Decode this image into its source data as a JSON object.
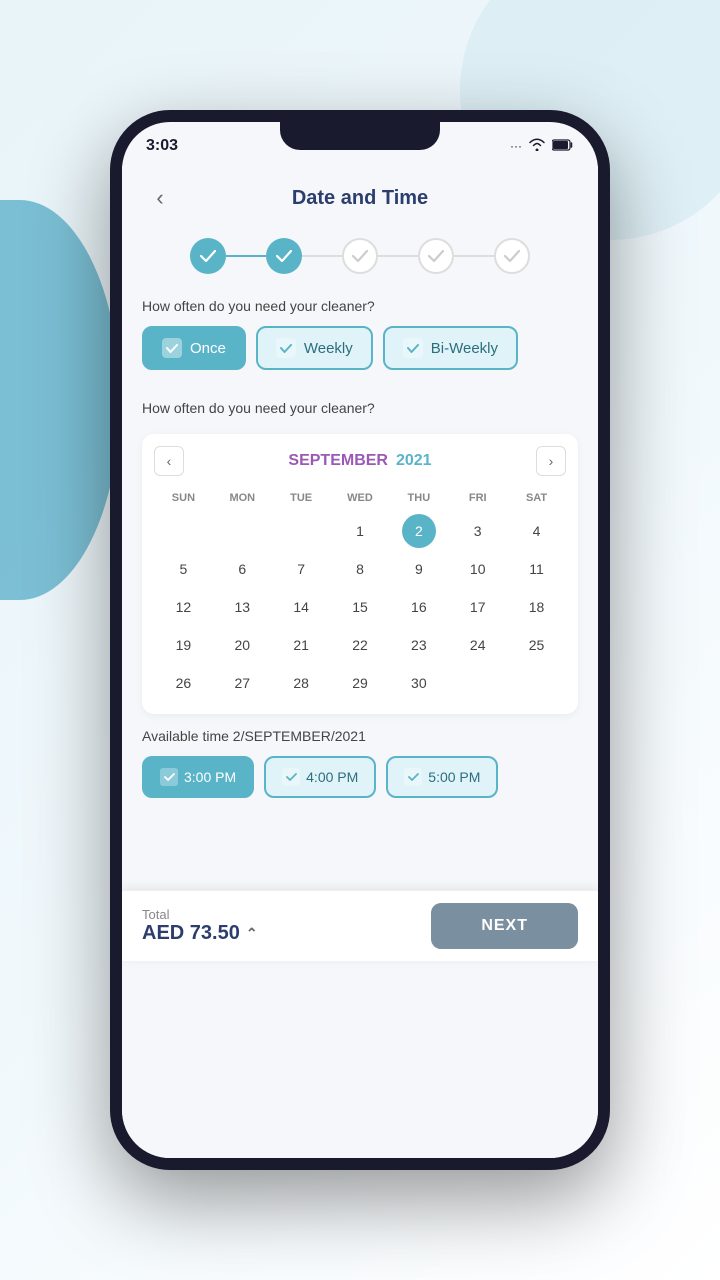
{
  "statusBar": {
    "time": "3:03",
    "icons": "... ✦ 📶 🔋"
  },
  "header": {
    "backLabel": "‹",
    "title": "Date and Time"
  },
  "progressSteps": [
    {
      "id": 1,
      "status": "active"
    },
    {
      "id": 2,
      "status": "active"
    },
    {
      "id": 3,
      "status": "inactive"
    },
    {
      "id": 4,
      "status": "inactive"
    },
    {
      "id": 5,
      "status": "inactive"
    }
  ],
  "frequencySection": {
    "label": "How often do you need your cleaner?",
    "options": [
      {
        "id": "once",
        "label": "Once",
        "selected": true
      },
      {
        "id": "weekly",
        "label": "Weekly",
        "selected": false
      },
      {
        "id": "biweekly",
        "label": "Bi-Weekly",
        "selected": false
      }
    ]
  },
  "calendarSection": {
    "label": "How often do you need your cleaner?",
    "prevIcon": "‹",
    "nextIcon": "›",
    "month": "SEPTEMBER",
    "year": "2021",
    "dayHeaders": [
      "SUN",
      "MON",
      "TUE",
      "WED",
      "THU",
      "FRI",
      "SAT"
    ],
    "selectedDay": 2,
    "weeks": [
      [
        "",
        "",
        "",
        "1",
        "2",
        "3",
        "4"
      ],
      [
        "5",
        "6",
        "7",
        "8",
        "9",
        "10",
        "11"
      ],
      [
        "12",
        "13",
        "14",
        "15",
        "16",
        "17",
        "18"
      ],
      [
        "19",
        "20",
        "21",
        "22",
        "23",
        "24",
        "25"
      ],
      [
        "26",
        "27",
        "28",
        "29",
        "30",
        "",
        ""
      ]
    ]
  },
  "timeSection": {
    "label": "Available time 2/SEPTEMBER/2021",
    "times": [
      {
        "id": "3pm",
        "label": "3:00 PM",
        "selected": true
      },
      {
        "id": "4pm",
        "label": "4:00 PM",
        "selected": false
      },
      {
        "id": "5pm",
        "label": "5:00 PM",
        "selected": false
      }
    ]
  },
  "bottomBar": {
    "totalLabel": "Total",
    "amount": "AED 73.50",
    "caretIcon": "⌃",
    "nextLabel": "NEXT"
  }
}
